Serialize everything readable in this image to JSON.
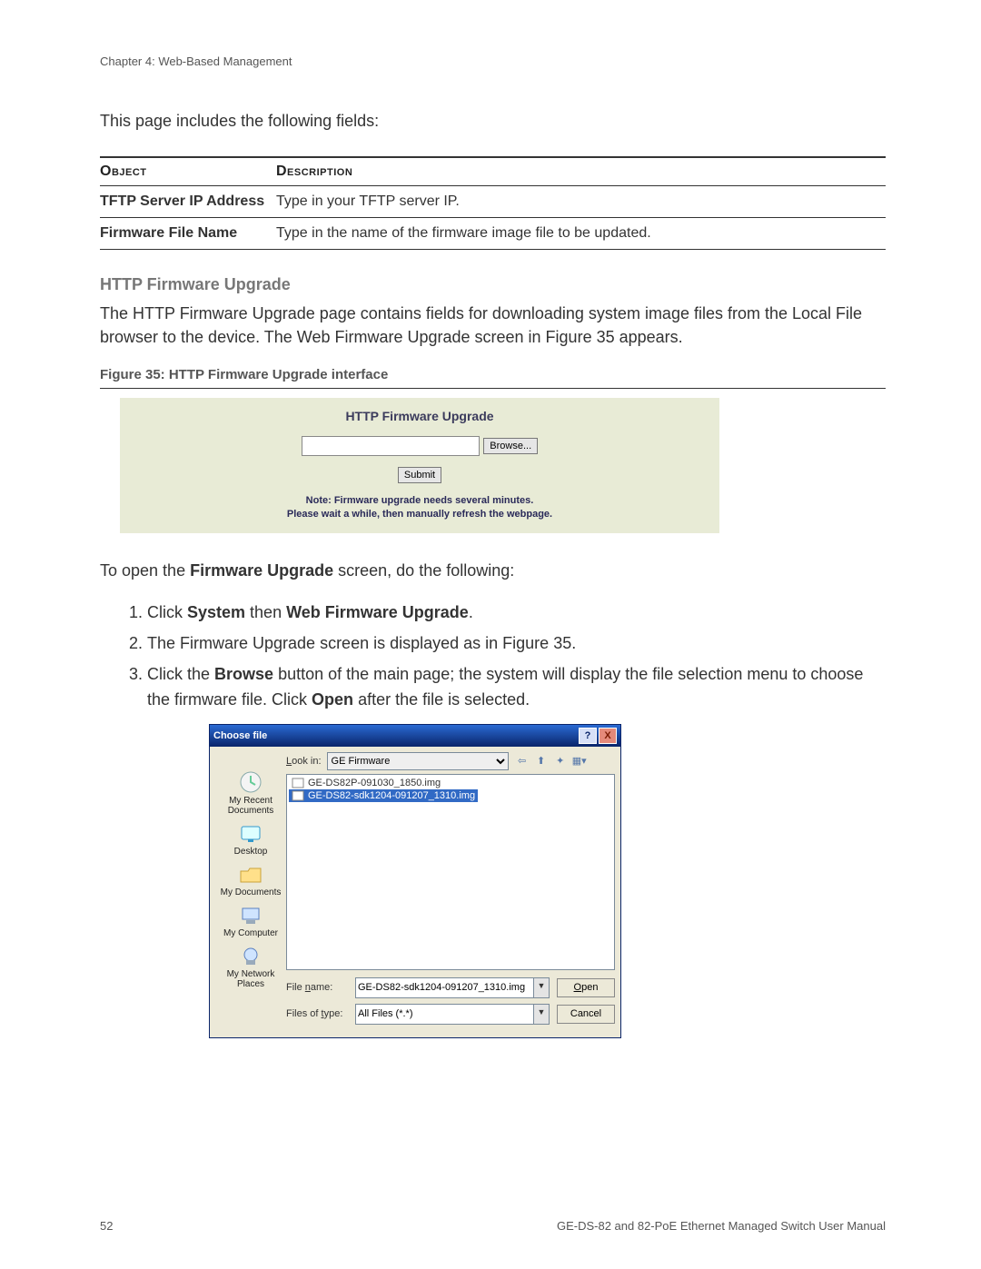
{
  "chapter": "Chapter 4: Web-Based Management",
  "intro": "This page includes the following fields:",
  "table": {
    "headers": [
      "Object",
      "Description"
    ],
    "rows": [
      {
        "obj": "TFTP Server IP Address",
        "desc": "Type in your TFTP server IP."
      },
      {
        "obj": "Firmware File Name",
        "desc": "Type in the name of the firmware image file to be updated."
      }
    ]
  },
  "section_title": "HTTP Firmware Upgrade",
  "section_body": "The HTTP Firmware Upgrade page contains fields for downloading system image files from the Local File browser to the device. The Web Firmware Upgrade screen in Figure 35 appears.",
  "figure_caption": "Figure 35:  HTTP Firmware Upgrade interface",
  "panel": {
    "title": "HTTP Firmware Upgrade",
    "browse": "Browse...",
    "submit": "Submit",
    "note_l1": "Note: Firmware upgrade needs several minutes.",
    "note_l2": "Please wait a while, then manually refresh the webpage."
  },
  "instruction_intro_pre": "To open the ",
  "instruction_intro_bold": "Firmware Upgrade",
  "instruction_intro_post": " screen, do the following:",
  "steps": {
    "s1_pre": "Click ",
    "s1_b1": "System",
    "s1_mid": " then ",
    "s1_b2": "Web Firmware Upgrade",
    "s1_post": ".",
    "s2": "The Firmware Upgrade screen is displayed as in Figure 35.",
    "s3_pre": "Click the ",
    "s3_b1": "Browse",
    "s3_mid": " button of    the main page; the system will display the file selection menu to choose the firmware file. Click ",
    "s3_b2": "Open",
    "s3_post": " after the file is selected."
  },
  "dialog": {
    "title": "Choose file",
    "help": "?",
    "close": "X",
    "lookin_label": "Look in:",
    "lookin_value": "GE Firmware",
    "places": [
      "My Recent Documents",
      "Desktop",
      "My Documents",
      "My Computer",
      "My Network Places"
    ],
    "files": [
      "GE-DS82P-091030_1850.img",
      "GE-DS82-sdk1204-091207_1310.img"
    ],
    "filename_label": "File name:",
    "filename_value": "GE-DS82-sdk1204-091207_1310.img",
    "filetype_label": "Files of type:",
    "filetype_value": "All Files (*.*)",
    "open": "Open",
    "cancel": "Cancel"
  },
  "footer_left": "52",
  "footer_right": "GE-DS-82 and 82-PoE Ethernet Managed Switch User Manual"
}
